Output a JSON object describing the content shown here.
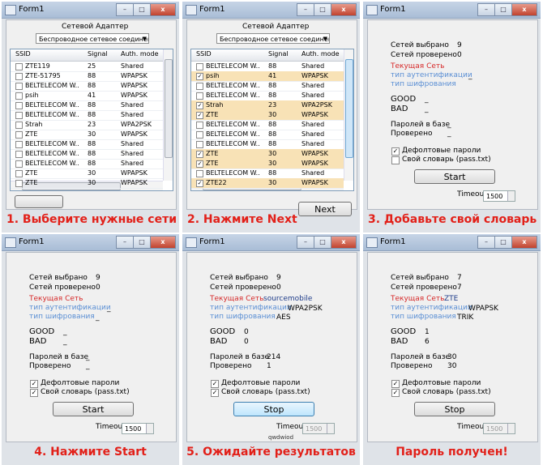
{
  "window_title": "Form1",
  "window_buttons": {
    "minimize": "–",
    "maximize": "□",
    "close": "x"
  },
  "adapter": {
    "heading": "Сетевой Адаптер",
    "selected": "Беспроводное сетевое соединени"
  },
  "table": {
    "headers": [
      "SSID",
      "Signal",
      "Auth. mode"
    ]
  },
  "panel1": {
    "rows": [
      {
        "ssid": "ZTE119",
        "signal": "25",
        "auth": "Shared",
        "checked": false,
        "hl": false
      },
      {
        "ssid": "ZTE-51795",
        "signal": "88",
        "auth": "WPAPSK",
        "checked": false,
        "hl": false
      },
      {
        "ssid": "BELTELECOM W...",
        "signal": "88",
        "auth": "WPAPSK",
        "checked": false,
        "hl": false
      },
      {
        "ssid": "psih",
        "signal": "41",
        "auth": "WPAPSK",
        "checked": false,
        "hl": false
      },
      {
        "ssid": "BELTELECOM W...",
        "signal": "88",
        "auth": "Shared",
        "checked": false,
        "hl": false
      },
      {
        "ssid": "BELTELECOM W...",
        "signal": "88",
        "auth": "Shared",
        "checked": false,
        "hl": false
      },
      {
        "ssid": "Strah",
        "signal": "23",
        "auth": "WPA2PSK",
        "checked": false,
        "hl": false
      },
      {
        "ssid": "ZTE",
        "signal": "30",
        "auth": "WPAPSK",
        "checked": false,
        "hl": false
      },
      {
        "ssid": "BELTELECOM W...",
        "signal": "88",
        "auth": "Shared",
        "checked": false,
        "hl": false
      },
      {
        "ssid": "BELTELECOM W...",
        "signal": "88",
        "auth": "Shared",
        "checked": false,
        "hl": false
      },
      {
        "ssid": "BELTELECOM W...",
        "signal": "88",
        "auth": "Shared",
        "checked": false,
        "hl": false
      },
      {
        "ssid": "ZTE",
        "signal": "30",
        "auth": "WPAPSK",
        "checked": false,
        "hl": false
      },
      {
        "ssid": "ZTE",
        "signal": "30",
        "auth": "WPAPSK",
        "checked": false,
        "hl": false
      }
    ],
    "caption": "1. Выберите нужные сети"
  },
  "panel2": {
    "rows": [
      {
        "ssid": "BELTELECOM W...",
        "signal": "88",
        "auth": "Shared",
        "checked": false,
        "hl": false
      },
      {
        "ssid": "psih",
        "signal": "41",
        "auth": "WPAPSK",
        "checked": true,
        "hl": true
      },
      {
        "ssid": "BELTELECOM W...",
        "signal": "88",
        "auth": "Shared",
        "checked": false,
        "hl": false
      },
      {
        "ssid": "BELTELECOM W...",
        "signal": "88",
        "auth": "Shared",
        "checked": false,
        "hl": false
      },
      {
        "ssid": "Strah",
        "signal": "23",
        "auth": "WPA2PSK",
        "checked": true,
        "hl": true
      },
      {
        "ssid": "ZTE",
        "signal": "30",
        "auth": "WPAPSK",
        "checked": true,
        "hl": true
      },
      {
        "ssid": "BELTELECOM W...",
        "signal": "88",
        "auth": "Shared",
        "checked": false,
        "hl": false
      },
      {
        "ssid": "BELTELECOM W...",
        "signal": "88",
        "auth": "Shared",
        "checked": false,
        "hl": false
      },
      {
        "ssid": "BELTELECOM W...",
        "signal": "88",
        "auth": "Shared",
        "checked": false,
        "hl": false
      },
      {
        "ssid": "ZTE",
        "signal": "30",
        "auth": "WPAPSK",
        "checked": true,
        "hl": true
      },
      {
        "ssid": "ZTE",
        "signal": "30",
        "auth": "WPAPSK",
        "checked": true,
        "hl": true
      },
      {
        "ssid": "BELTELECOM W...",
        "signal": "88",
        "auth": "Shared",
        "checked": false,
        "hl": false
      },
      {
        "ssid": "ZTE22",
        "signal": "30",
        "auth": "WPAPSK",
        "checked": true,
        "hl": true
      }
    ],
    "next_label": "Next",
    "caption": "2. Нажмите Next"
  },
  "labels": {
    "networks_selected": "Сетей выбрано",
    "networks_checked": "Сетей проверено",
    "current_network": "Текущая Сеть",
    "auth_type": "тип аутентификации",
    "cipher_type": "тип шифрования",
    "good": "GOOD",
    "bad": "BAD",
    "passwords_in_db": "Паролей в базе",
    "checked": "Проверено",
    "default_passwords": "Дефолтовые пароли",
    "own_dictionary": "Свой словарь (pass.txt)",
    "timeout": "Timeout"
  },
  "panel3": {
    "selected": "9",
    "checked_count": "0",
    "current": "",
    "auth": "_",
    "cipher": "",
    "good": "_",
    "bad": "_",
    "db": "_",
    "verified": "_",
    "default_checked": true,
    "own_checked": false,
    "button": "Start",
    "timeout": "1500",
    "caption": "3. Добавьте свой словарь"
  },
  "panel4": {
    "selected": "9",
    "checked_count": "0",
    "current": "",
    "auth": "_",
    "cipher": "_",
    "good": "_",
    "bad": "_",
    "db": "_",
    "verified": "_",
    "default_checked": true,
    "own_checked": true,
    "button": "Start",
    "timeout": "1500",
    "caption": "4. Нажмите Start"
  },
  "panel5": {
    "selected": "9",
    "checked_count": "0",
    "current": "sourcemobile",
    "auth": "WPA2PSK",
    "cipher": "AES",
    "good": "0",
    "bad": "0",
    "db": "214",
    "verified": "1",
    "default_checked": true,
    "own_checked": true,
    "button": "Stop",
    "timeout": "1500",
    "extra": "qwdwiod",
    "caption": "5. Ожидайте результатов"
  },
  "panel6": {
    "selected": "7",
    "checked_count": "7",
    "current": "ZTE",
    "auth": "WPAPSK",
    "cipher": "TRIK",
    "good": "1",
    "bad": "6",
    "db": "30",
    "verified": "30",
    "default_checked": true,
    "own_checked": true,
    "button": "Stop",
    "timeout": "1500",
    "caption": "Пароль получен!"
  }
}
